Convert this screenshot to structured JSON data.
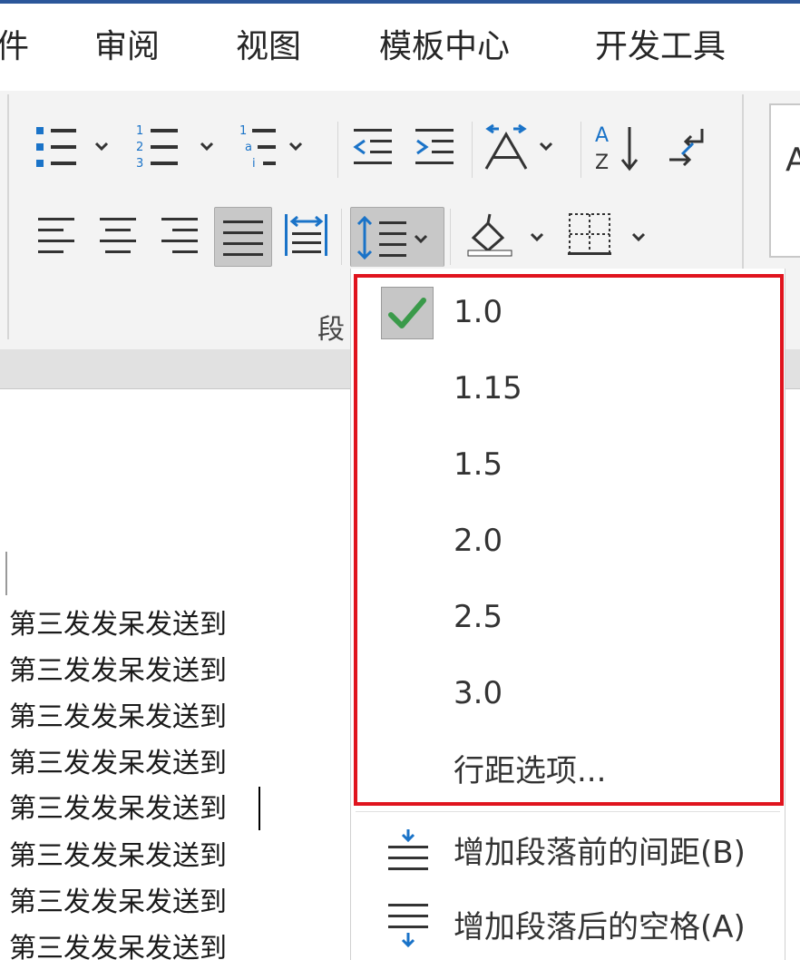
{
  "tabs": [
    {
      "label": "件"
    },
    {
      "label": "审阅"
    },
    {
      "label": "视图"
    },
    {
      "label": "模板中心"
    },
    {
      "label": "开发工具"
    }
  ],
  "ribbon": {
    "paragraph_group_label": "段",
    "style_preview_text": "A"
  },
  "line_spacing_menu": {
    "options": [
      {
        "label": "1.0",
        "checked": true
      },
      {
        "label": "1.15",
        "checked": false
      },
      {
        "label": "1.5",
        "checked": false
      },
      {
        "label": "2.0",
        "checked": false
      },
      {
        "label": "2.5",
        "checked": false
      },
      {
        "label": "3.0",
        "checked": false
      }
    ],
    "more_options_label": "行距选项...",
    "add_space_before_label": "增加段落前的间距(B)",
    "add_space_after_label": "增加段落后的空格(A)"
  },
  "document": {
    "lines": [
      "第三发发呆发送到",
      "第三发发呆发送到",
      "第三发发呆发送到",
      "第三发发呆发送到",
      "第三发发呆发送到",
      "第三发发呆发送到",
      "第三发发呆发送到",
      "第三发发呆发送到"
    ]
  },
  "colors": {
    "accent": "#2b579a",
    "icon_blue": "#1a73c8",
    "check_green": "#3a9a4a",
    "highlight_red": "#e0141e"
  }
}
